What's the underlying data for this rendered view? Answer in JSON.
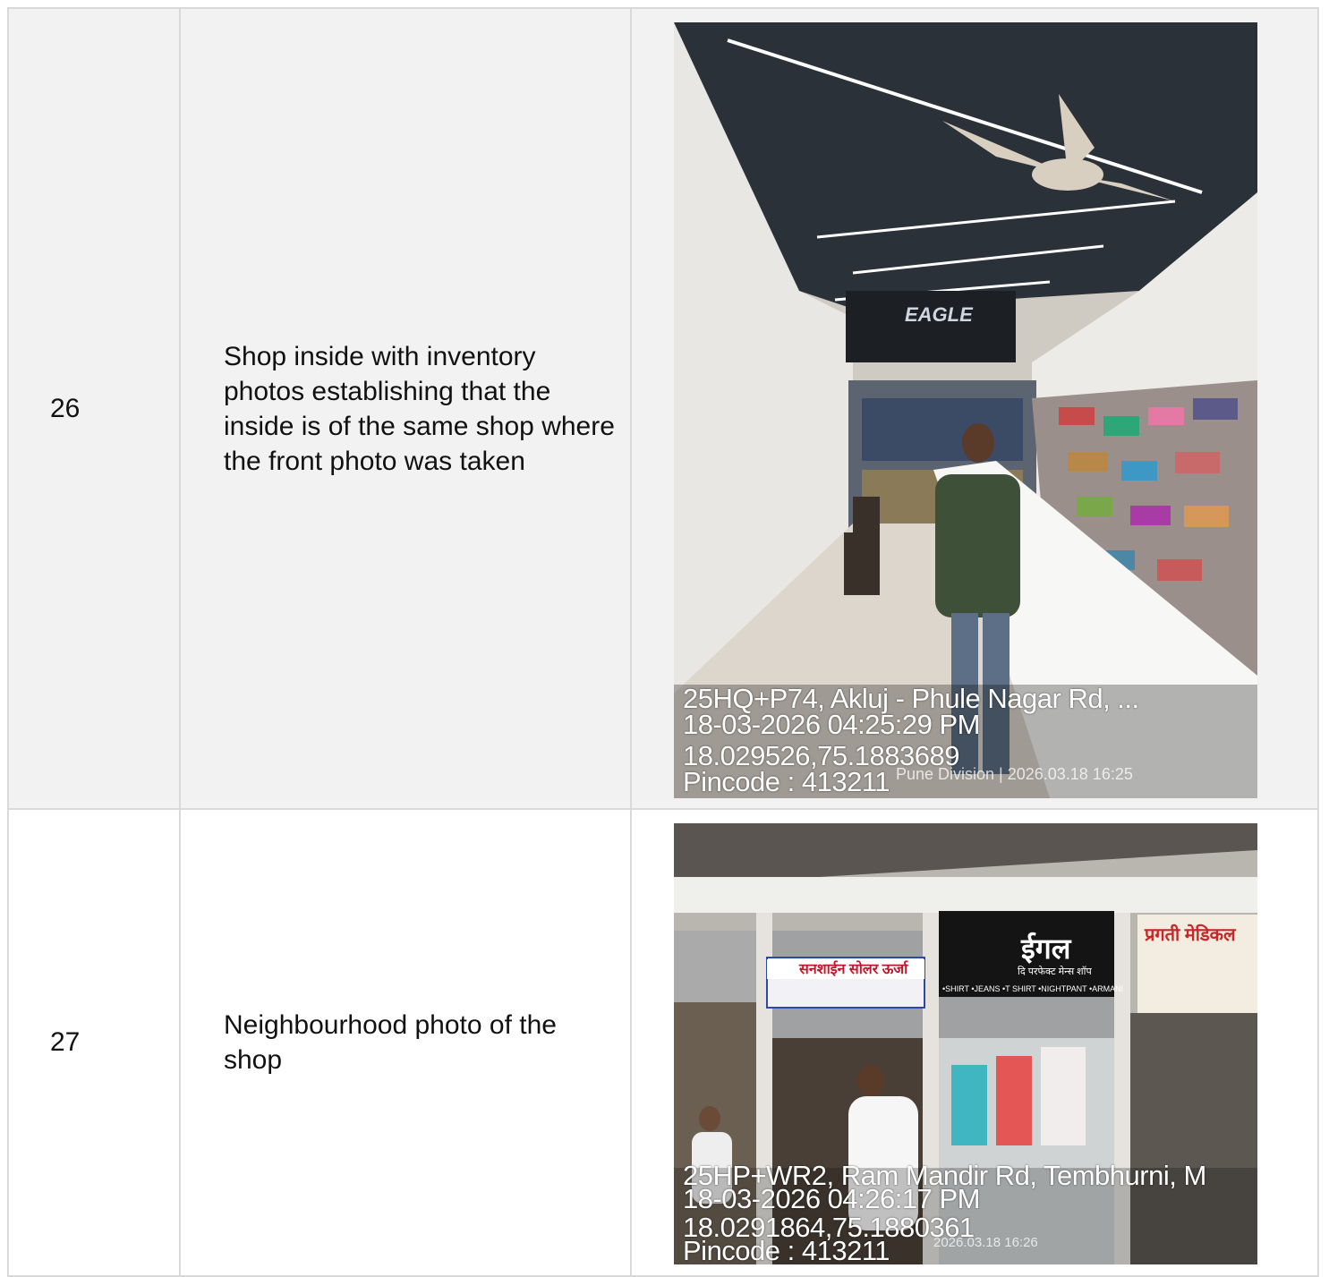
{
  "rows": [
    {
      "number": "26",
      "description": "Shop inside with inventory photos establishing that the inside is of the same shop where the front photo was taken",
      "overlay": {
        "address": "25HQ+P74, Akluj - Phule Nagar Rd, ...",
        "datetime": "18-03-2026 04:25:29 PM",
        "coords": "18.029526,75.1883689",
        "pincode": "Pincode : 413211",
        "stamp": "Pune Division | 2026.03.18 16:25"
      },
      "sign_text": "EAGLE"
    },
    {
      "number": "27",
      "description": "Neighbourhood photo of the shop",
      "overlay": {
        "address": "25HP+WR2, Ram Mandir Rd, Tembhurni, M",
        "datetime": "18-03-2026 04:26:17 PM",
        "coords": "18.0291864,75.1880361",
        "pincode": "Pincode : 413211",
        "stamp": "2026.03.18 16:26"
      },
      "signs": {
        "solar": "सनशाईन सोलर ऊर्जा",
        "eagle_hi": "ईगल",
        "eagle_sub": "दि परफेक्ट मेन्स शॉप",
        "eagle_items": "•SHIRT •JEANS •T SHIRT •NIGHTPANT •ARMANI",
        "pragati": "प्रगती मेडिकल"
      }
    }
  ]
}
